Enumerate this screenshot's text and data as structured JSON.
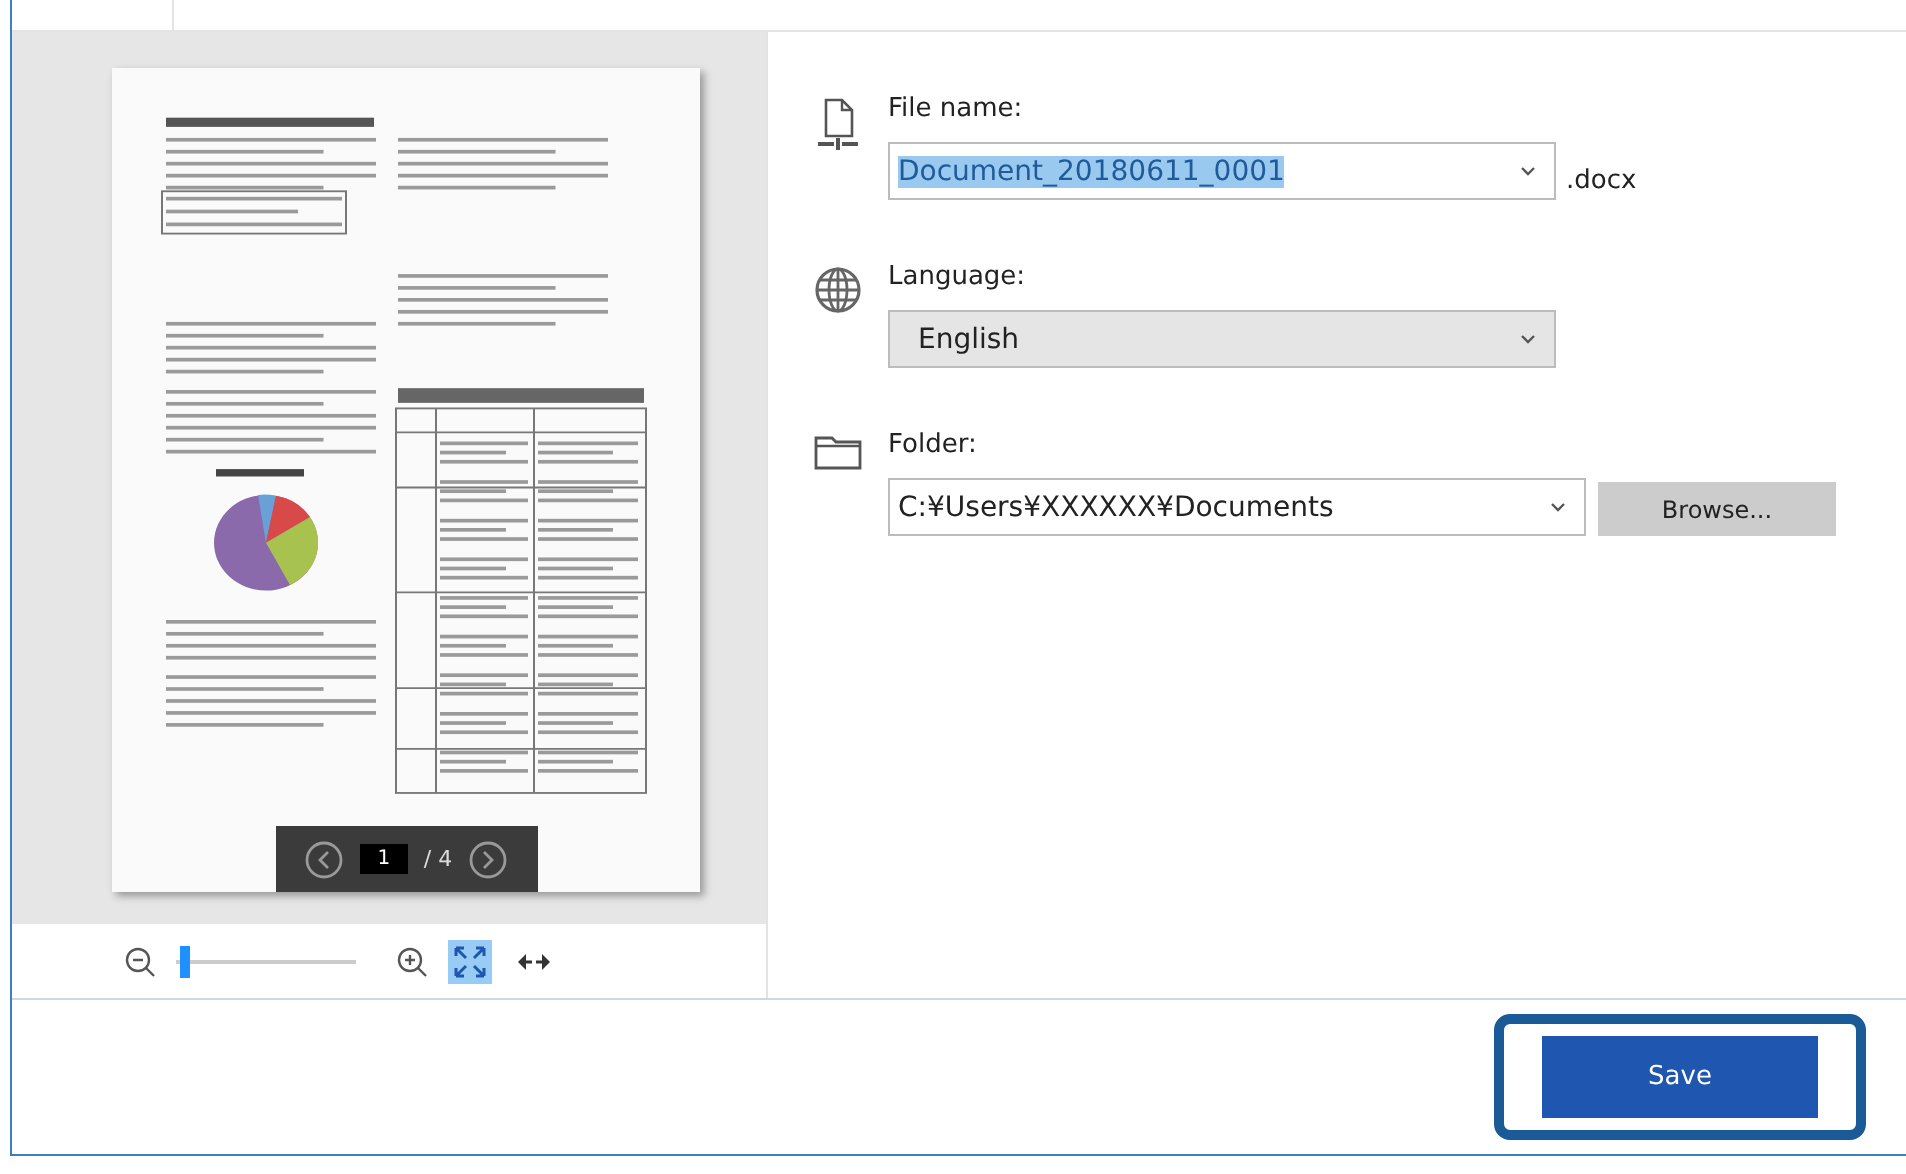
{
  "preview": {
    "page_nav": {
      "current_page": "1",
      "total": "/ 4"
    },
    "zoom": {
      "level": 0.03
    },
    "view_modes": [
      {
        "kind": "fit-page",
        "selected": true
      },
      {
        "kind": "fit-width",
        "selected": false
      }
    ]
  },
  "fields": [
    {
      "kind": "filename",
      "label": "File name:",
      "value": "Document_20180611_0001",
      "text_selected": true,
      "extension": ".docx"
    },
    {
      "kind": "language",
      "label": "Language:",
      "value": "English"
    },
    {
      "kind": "folder",
      "label": "Folder:",
      "value": "C:¥Users¥XXXXXX¥Documents",
      "button": "Browse..."
    }
  ],
  "save_button": {
    "label": "Save",
    "highlighted": true
  }
}
